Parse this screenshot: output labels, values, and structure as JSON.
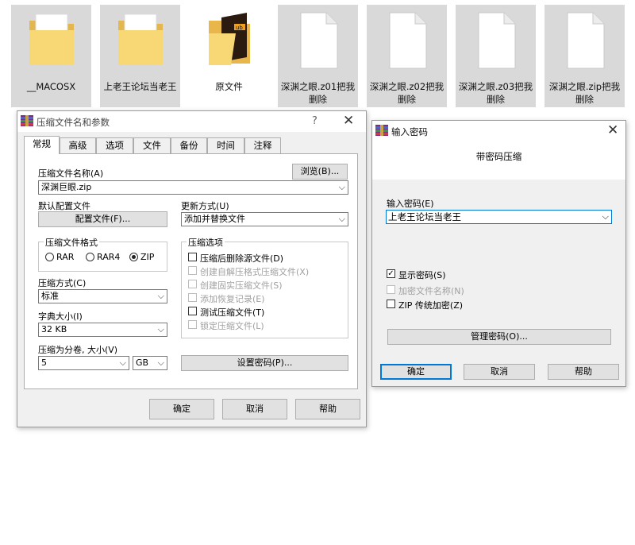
{
  "files": [
    {
      "name": "__MACOSX",
      "icon": "folder-icon"
    },
    {
      "name": "上老王论坛当老王",
      "icon": "folder-icon"
    },
    {
      "name": "原文件",
      "icon": "folder-image-icon"
    },
    {
      "name": "深渊之眼.z01把我删除",
      "icon": "file-icon"
    },
    {
      "name": "深渊之眼.z02把我删除",
      "icon": "file-icon"
    },
    {
      "name": "深渊之眼.z03把我删除",
      "icon": "file-icon"
    },
    {
      "name": "深渊之眼.zip把我删除",
      "icon": "file-icon"
    }
  ],
  "file_thumb_overlay": "ub",
  "archive_dialog": {
    "title": "压缩文件名和参数",
    "help_glyph": "?",
    "close_glyph": "✕",
    "tabs": [
      "常规",
      "高级",
      "选项",
      "文件",
      "备份",
      "时间",
      "注释"
    ],
    "archive_name_label": "压缩文件名称(A)",
    "browse_button": "浏览(B)...",
    "archive_name_value": "深渊巨眼.zip",
    "default_profile_label": "默认配置文件",
    "profiles_button": "配置文件(F)...",
    "update_mode_label": "更新方式(U)",
    "update_mode_value": "添加并替换文件",
    "format_group_title": "压缩文件格式",
    "formats": [
      {
        "label": "RAR",
        "selected": false
      },
      {
        "label": "RAR4",
        "selected": false
      },
      {
        "label": "ZIP",
        "selected": true
      }
    ],
    "options_group_title": "压缩选项",
    "options": [
      {
        "label": "压缩后删除源文件(D)",
        "checked": false,
        "enabled": true
      },
      {
        "label": "创建自解压格式压缩文件(X)",
        "checked": false,
        "enabled": false
      },
      {
        "label": "创建固实压缩文件(S)",
        "checked": false,
        "enabled": false
      },
      {
        "label": "添加恢复记录(E)",
        "checked": false,
        "enabled": false
      },
      {
        "label": "测试压缩文件(T)",
        "checked": false,
        "enabled": true
      },
      {
        "label": "锁定压缩文件(L)",
        "checked": false,
        "enabled": false
      }
    ],
    "method_label": "压缩方式(C)",
    "method_value": "标准",
    "dict_label": "字典大小(I)",
    "dict_value": "32 KB",
    "split_label": "压缩为分卷, 大小(V)",
    "split_value": "5",
    "split_unit": "GB",
    "set_password_button": "设置密码(P)...",
    "ok_button": "确定",
    "cancel_button": "取消",
    "help_button": "帮助"
  },
  "password_dialog": {
    "title": "输入密码",
    "close_glyph": "✕",
    "heading": "带密码压缩",
    "enter_password_label": "输入密码(E)",
    "password_value": "上老王论坛当老王",
    "show_password": {
      "label": "显示密码(S)",
      "checked": true
    },
    "encrypt_names": {
      "label": "加密文件名称(N)",
      "checked": false,
      "enabled": false
    },
    "zip_legacy": {
      "label": "ZIP 传统加密(Z)",
      "checked": false
    },
    "manage_button": "管理密码(O)...",
    "ok_button": "确定",
    "cancel_button": "取消",
    "help_button": "帮助"
  },
  "colors": {
    "focus_blue": "#0078d7",
    "folder_yellow": "#f8d775",
    "tile_selected": "#d9d9d9"
  }
}
